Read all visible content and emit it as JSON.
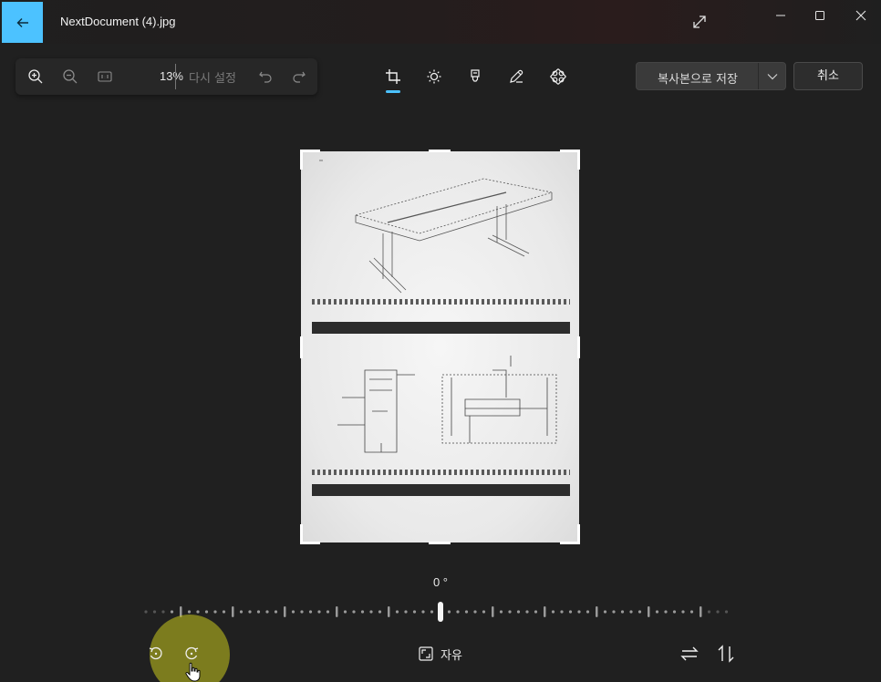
{
  "window": {
    "title": "NextDocument (4).jpg"
  },
  "zoom_toolbar": {
    "zoom_value": "13%",
    "reset_label": "다시 설정"
  },
  "edit_tools": {
    "active": "crop",
    "items": [
      "crop",
      "adjust",
      "highlighter",
      "markup",
      "effects"
    ]
  },
  "actions": {
    "save_copy_label": "복사본으로 저장",
    "cancel_label": "취소"
  },
  "crop": {
    "angle_label": "0 °",
    "aspect_label": "자유"
  },
  "colors": {
    "accent": "#4cc2ff",
    "background": "#202020",
    "click_highlight": "#c8c81e"
  }
}
